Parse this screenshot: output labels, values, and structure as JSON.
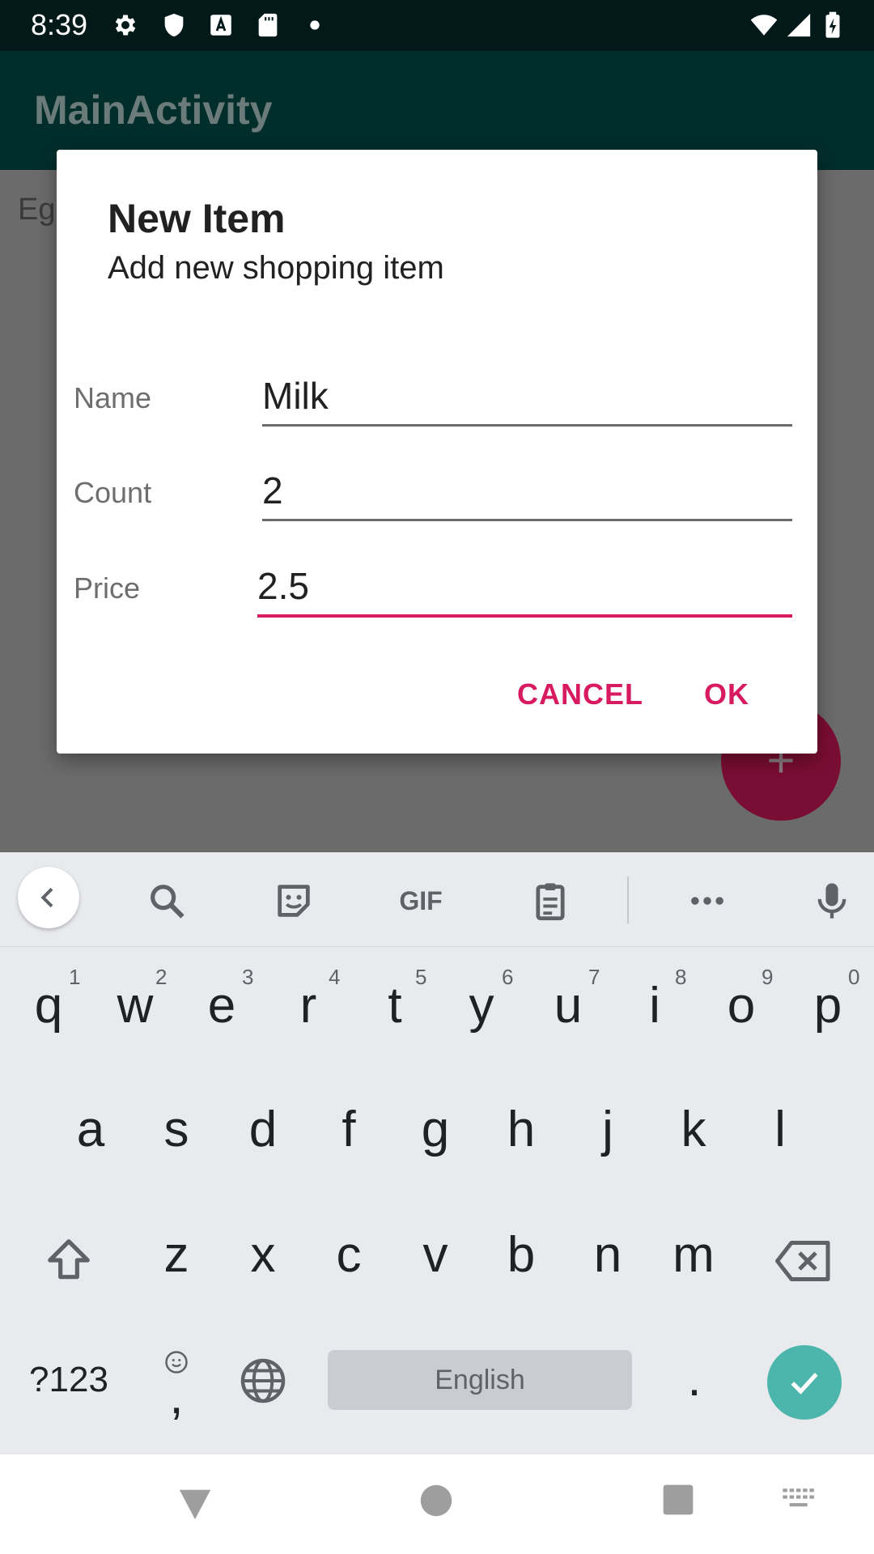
{
  "status_bar": {
    "time": "8:39"
  },
  "app_bar": {
    "title": "MainActivity"
  },
  "content": {
    "first_item": "Eggs"
  },
  "dialog": {
    "title": "New Item",
    "subtitle": "Add new shopping item",
    "fields": [
      {
        "label": "Name",
        "value": "Milk"
      },
      {
        "label": "Count",
        "value": "2"
      },
      {
        "label": "Price",
        "value": "2.5"
      }
    ],
    "cancel_label": "CANCEL",
    "ok_label": "OK"
  },
  "keyboard": {
    "toolbar": {
      "gif_label": "GIF"
    },
    "row1": [
      "q",
      "w",
      "e",
      "r",
      "t",
      "y",
      "u",
      "i",
      "o",
      "p"
    ],
    "row1_hints": [
      "1",
      "2",
      "3",
      "4",
      "5",
      "6",
      "7",
      "8",
      "9",
      "0"
    ],
    "row2": [
      "a",
      "s",
      "d",
      "f",
      "g",
      "h",
      "j",
      "k",
      "l"
    ],
    "row3": [
      "z",
      "x",
      "c",
      "v",
      "b",
      "n",
      "m"
    ],
    "symbols_label": "?123",
    "comma_label": ",",
    "space_label": "English",
    "period_label": "."
  },
  "colors": {
    "accent": "#d81b60",
    "status_bar": "#011a19",
    "app_bar": "#012d2b",
    "enter_key": "#4db6ac"
  }
}
